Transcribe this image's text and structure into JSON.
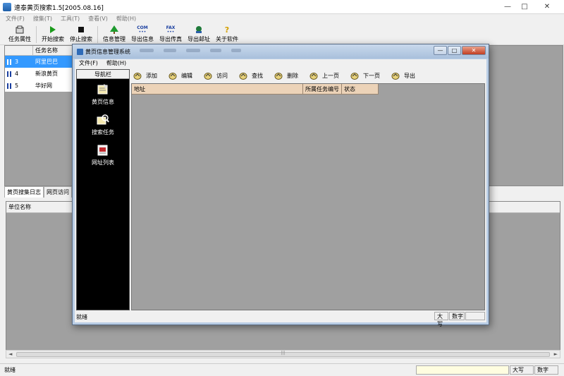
{
  "window": {
    "title": "速泰黄页搜索1.5[2005.08.16]",
    "controls": {
      "minimize": "—",
      "maximize": "□",
      "close": "✕"
    }
  },
  "menu": [
    "文件(F)",
    "搜集(T)",
    "工具(T)",
    "查看(V)",
    "帮助(H)"
  ],
  "toolbar": [
    {
      "label": "任务属性",
      "icon": "properties-icon"
    },
    {
      "label": "开始搜索",
      "icon": "play-icon"
    },
    {
      "label": "停止搜索",
      "icon": "stop-icon"
    },
    {
      "label": "信息管理",
      "icon": "tree-icon"
    },
    {
      "label": "导出信息",
      "icon": "export-com-icon",
      "icon_text": "COM"
    },
    {
      "label": "导出传真",
      "icon": "export-fax-icon",
      "icon_text": "FAX"
    },
    {
      "label": "导出邮址",
      "icon": "export-email-icon"
    },
    {
      "label": "关于软件",
      "icon": "help-icon",
      "icon_text": "?"
    }
  ],
  "task_list": {
    "header": "任务名称",
    "rows": [
      {
        "id": "3",
        "name": "阿里巴巴",
        "selected": true
      },
      {
        "id": "4",
        "name": "新浪黄页",
        "selected": false
      },
      {
        "id": "5",
        "name": "华好网",
        "selected": false
      }
    ]
  },
  "log_tabs": [
    "黄页搜集日志",
    "网页访问"
  ],
  "log_table": {
    "header": "单位名称"
  },
  "status": {
    "text": "就绪",
    "caps": "大写",
    "num": "数字"
  },
  "dialog": {
    "title": "黄页信息管理系统",
    "menu": [
      "文件(F)",
      "帮助(H)"
    ],
    "nav_header": "导航栏",
    "nav_items": [
      {
        "label": "黄页信息",
        "icon": "yellow-pages-icon"
      },
      {
        "label": "搜索任务",
        "icon": "search-task-icon"
      },
      {
        "label": "网址列表",
        "icon": "url-list-icon"
      }
    ],
    "toolbar": [
      "添加",
      "编辑",
      "访问",
      "查找",
      "删除",
      "上一页",
      "下一页",
      "导出"
    ],
    "grid_columns": [
      "地址",
      "所属任务编号",
      "状态"
    ],
    "status": {
      "text": "就绪",
      "caps": "大写",
      "num": "数字"
    }
  }
}
